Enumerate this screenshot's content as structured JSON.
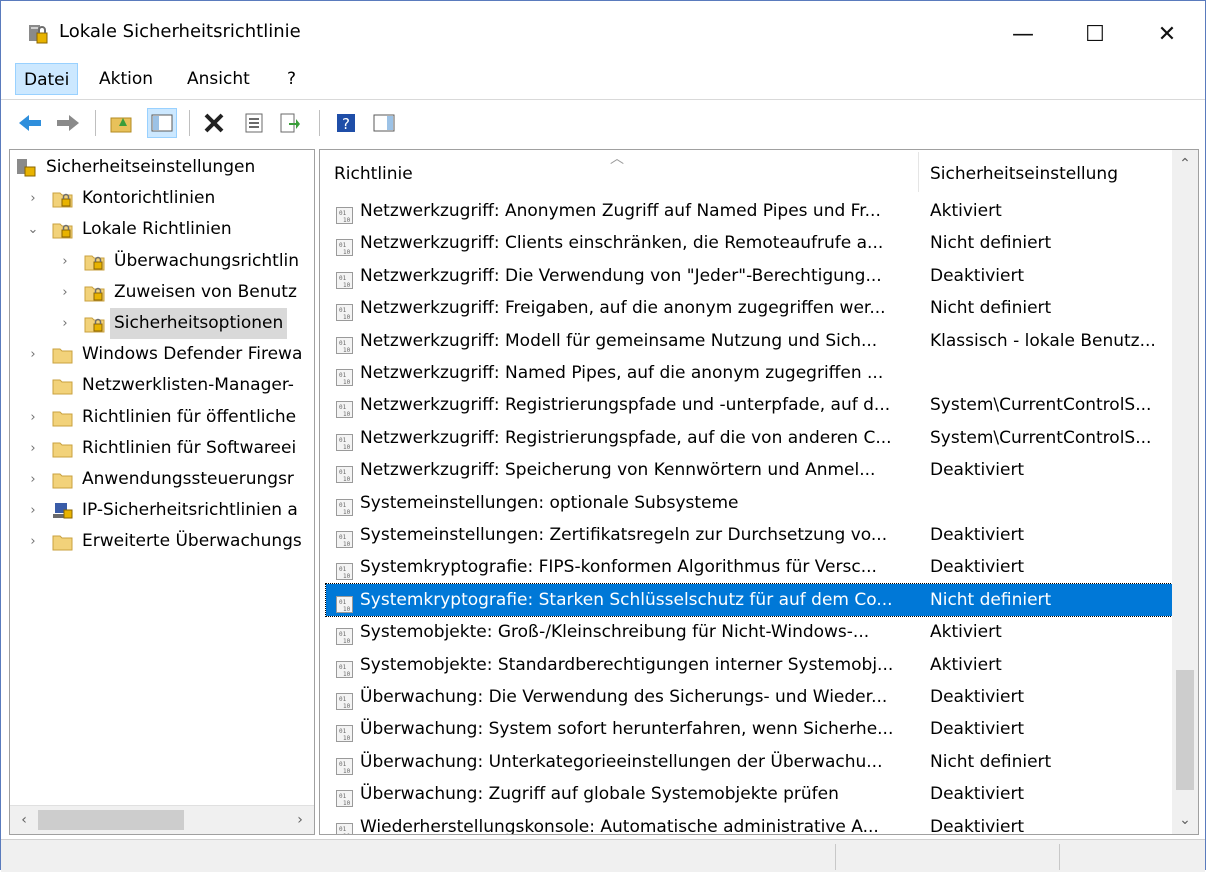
{
  "window": {
    "title": "Lokale Sicherheitsrichtlinie",
    "minimize": "—",
    "maximize": "☐",
    "close": "✕"
  },
  "menu": [
    {
      "label": "Datei"
    },
    {
      "label": "Aktion"
    },
    {
      "label": "Ansicht"
    },
    {
      "label": "?"
    }
  ],
  "tree": [
    {
      "label": "Sicherheitseinstellungen",
      "level": 0,
      "expander": "",
      "icon": "security-settings-icon"
    },
    {
      "label": "Kontorichtlinien",
      "level": 1,
      "expander": "›",
      "icon": "folder-lock-icon"
    },
    {
      "label": "Lokale Richtlinien",
      "level": 1,
      "expander": "⌄",
      "icon": "folder-lock-icon"
    },
    {
      "label": "Überwachungsrichtlin",
      "level": 2,
      "expander": "›",
      "icon": "folder-lock-icon"
    },
    {
      "label": "Zuweisen von Benutz",
      "level": 2,
      "expander": "›",
      "icon": "folder-lock-icon"
    },
    {
      "label": "Sicherheitsoptionen",
      "level": 2,
      "expander": "›",
      "icon": "folder-lock-icon",
      "selected": true
    },
    {
      "label": "Windows Defender Firewa",
      "level": 1,
      "expander": "›",
      "icon": "folder-icon"
    },
    {
      "label": "Netzwerklisten-Manager-",
      "level": 1,
      "expander": "",
      "icon": "folder-icon"
    },
    {
      "label": "Richtlinien für öffentliche",
      "level": 1,
      "expander": "›",
      "icon": "folder-icon"
    },
    {
      "label": "Richtlinien für Softwareei",
      "level": 1,
      "expander": "›",
      "icon": "folder-icon"
    },
    {
      "label": "Anwendungssteuerungsr",
      "level": 1,
      "expander": "›",
      "icon": "folder-icon"
    },
    {
      "label": "IP-Sicherheitsrichtlinien a",
      "level": 1,
      "expander": "›",
      "icon": "ipsec-icon"
    },
    {
      "label": "Erweiterte Überwachungs",
      "level": 1,
      "expander": "›",
      "icon": "folder-icon"
    }
  ],
  "columns": {
    "policy": "Richtlinie",
    "setting": "Sicherheitseinstellung"
  },
  "rows": [
    {
      "policy": "Netzwerkzugriff: Anonymen Zugriff auf Named Pipes und Fr...",
      "setting": "Aktiviert"
    },
    {
      "policy": "Netzwerkzugriff: Clients einschränken, die Remoteaufrufe a...",
      "setting": "Nicht definiert"
    },
    {
      "policy": "Netzwerkzugriff: Die Verwendung von \"Jeder\"-Berechtigung...",
      "setting": "Deaktiviert"
    },
    {
      "policy": "Netzwerkzugriff: Freigaben, auf die anonym zugegriffen wer...",
      "setting": "Nicht definiert"
    },
    {
      "policy": "Netzwerkzugriff: Modell für gemeinsame Nutzung und Sich...",
      "setting": "Klassisch - lokale Benutz..."
    },
    {
      "policy": "Netzwerkzugriff: Named Pipes, auf die anonym zugegriffen ...",
      "setting": ""
    },
    {
      "policy": "Netzwerkzugriff: Registrierungspfade und -unterpfade, auf d...",
      "setting": "System\\CurrentControlS..."
    },
    {
      "policy": "Netzwerkzugriff: Registrierungspfade, auf die von anderen C...",
      "setting": "System\\CurrentControlS..."
    },
    {
      "policy": "Netzwerkzugriff: Speicherung von Kennwörtern und Anmel...",
      "setting": "Deaktiviert"
    },
    {
      "policy": "Systemeinstellungen: optionale Subsysteme",
      "setting": ""
    },
    {
      "policy": "Systemeinstellungen: Zertifikatsregeln zur Durchsetzung vo...",
      "setting": "Deaktiviert"
    },
    {
      "policy": "Systemkryptografie: FIPS-konformen Algorithmus für Versc...",
      "setting": "Deaktiviert"
    },
    {
      "policy": "Systemkryptografie: Starken Schlüsselschutz für auf dem Co...",
      "setting": "Nicht definiert",
      "selected": true
    },
    {
      "policy": "Systemobjekte: Groß-/Kleinschreibung für Nicht-Windows-...",
      "setting": "Aktiviert"
    },
    {
      "policy": "Systemobjekte: Standardberechtigungen interner Systemobj...",
      "setting": "Aktiviert"
    },
    {
      "policy": "Überwachung: Die Verwendung des Sicherungs- und Wieder...",
      "setting": "Deaktiviert"
    },
    {
      "policy": "Überwachung: System sofort herunterfahren, wenn Sicherhe...",
      "setting": "Deaktiviert"
    },
    {
      "policy": "Überwachung: Unterkategorieeinstellungen der Überwachu...",
      "setting": "Nicht definiert"
    },
    {
      "policy": "Überwachung: Zugriff auf globale Systemobjekte prüfen",
      "setting": "Deaktiviert"
    },
    {
      "policy": "Wiederherstellungskonsole: Automatische administrative A...",
      "setting": "Deaktiviert"
    }
  ],
  "toolbar": [
    {
      "name": "back-icon"
    },
    {
      "name": "forward-icon"
    },
    {
      "name": "up-folder-icon"
    },
    {
      "name": "show-hide-tree-icon"
    },
    {
      "name": "delete-icon"
    },
    {
      "name": "properties-icon"
    },
    {
      "name": "export-list-icon"
    },
    {
      "name": "help-icon"
    },
    {
      "name": "show-hide-action-pane-icon"
    }
  ]
}
